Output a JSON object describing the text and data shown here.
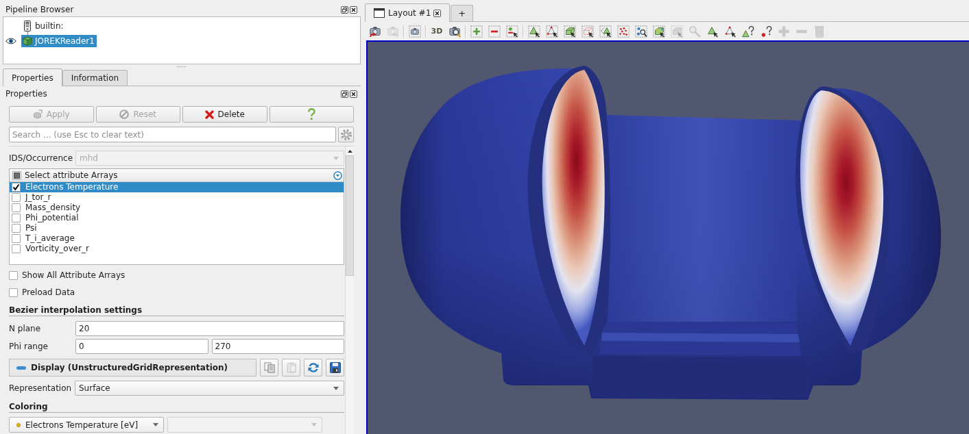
{
  "pipeline_browser": {
    "title": "Pipeline Browser",
    "items": [
      {
        "label": "builtin:",
        "kind": "server",
        "selected": false,
        "children": [
          {
            "label": "JOREKReader1",
            "kind": "source",
            "selected": true,
            "visible": true
          }
        ]
      }
    ]
  },
  "panel_tabs": [
    {
      "label": "Properties",
      "selected": true
    },
    {
      "label": "Information",
      "selected": false
    }
  ],
  "properties": {
    "title": "Properties",
    "buttons": [
      {
        "kind": "apply",
        "label": "Apply",
        "disabled": true
      },
      {
        "kind": "reset",
        "label": "Reset",
        "disabled": true
      },
      {
        "kind": "delete",
        "label": "Delete",
        "disabled": false
      },
      {
        "kind": "help",
        "disabled": false
      }
    ],
    "search": {
      "placeholder": "Search ... (use Esc to clear text)"
    },
    "ids_occurrence": {
      "label": "IDS/Occurrence",
      "value": "mhd",
      "disabled": true
    },
    "arrays": {
      "header": "Select attribute Arrays",
      "header_partial": true,
      "items": [
        {
          "label": "Electrons Temperature",
          "checked": true,
          "selected": true
        },
        {
          "label": "J_tor_r",
          "checked": false,
          "selected": false
        },
        {
          "label": "Mass_density",
          "checked": false,
          "selected": false
        },
        {
          "label": "Phi_potential",
          "checked": false,
          "selected": false
        },
        {
          "label": "Psi",
          "checked": false,
          "selected": false
        },
        {
          "label": "T_i_average",
          "checked": false,
          "selected": false
        },
        {
          "label": "Vorticity_over_r",
          "checked": false,
          "selected": false
        }
      ]
    },
    "options": [
      {
        "label": "Show All Attribute Arrays",
        "checked": false
      },
      {
        "label": "Preload Data",
        "checked": false
      }
    ],
    "bezier": {
      "title": "Bezier interpolation settings",
      "n_plane": {
        "label": "N plane",
        "value": "20"
      },
      "phi_range": {
        "label": "Phi range",
        "values": [
          "0",
          "270"
        ]
      }
    },
    "display": {
      "title": "Display (UnstructuredGridRepresentation)",
      "buttons": [
        {
          "kind": "copy",
          "disabled": false
        },
        {
          "kind": "paste",
          "disabled": true
        },
        {
          "kind": "reload",
          "disabled": false
        },
        {
          "kind": "save",
          "disabled": false
        }
      ],
      "representation": {
        "label": "Representation",
        "value": "Surface"
      }
    },
    "coloring": {
      "title": "Coloring",
      "array": "Electrons Temperature [eV]",
      "component": {
        "disabled": true
      }
    }
  },
  "layout_tabs": [
    {
      "kind": "layout",
      "label": "Layout #1",
      "selected": true,
      "closable": true
    },
    {
      "kind": "new",
      "label": "+",
      "selected": false
    }
  ],
  "view_toolbar": {
    "groups": [
      [
        {
          "disabled": false
        },
        {
          "disabled": true
        }
      ],
      [
        {
          "disabled": false
        }
      ],
      [
        {
          "label": "3D",
          "disabled": false
        },
        {
          "disabled": false
        }
      ],
      [
        {
          "disabled": false
        },
        {
          "disabled": false
        },
        {
          "disabled": false
        }
      ],
      [
        {
          "disabled": false
        },
        {
          "disabled": false
        },
        {
          "disabled": false
        },
        {
          "disabled": false
        },
        {
          "disabled": false
        },
        {
          "disabled": false
        },
        {
          "disabled": false
        },
        {
          "disabled": false
        },
        {
          "disabled": true
        },
        {
          "disabled": true
        },
        {
          "disabled": false
        },
        {
          "disabled": false
        },
        {
          "disabled": false
        },
        {
          "disabled": false
        },
        {
          "disabled": true
        },
        {
          "disabled": true
        },
        {
          "disabled": true
        }
      ]
    ]
  }
}
